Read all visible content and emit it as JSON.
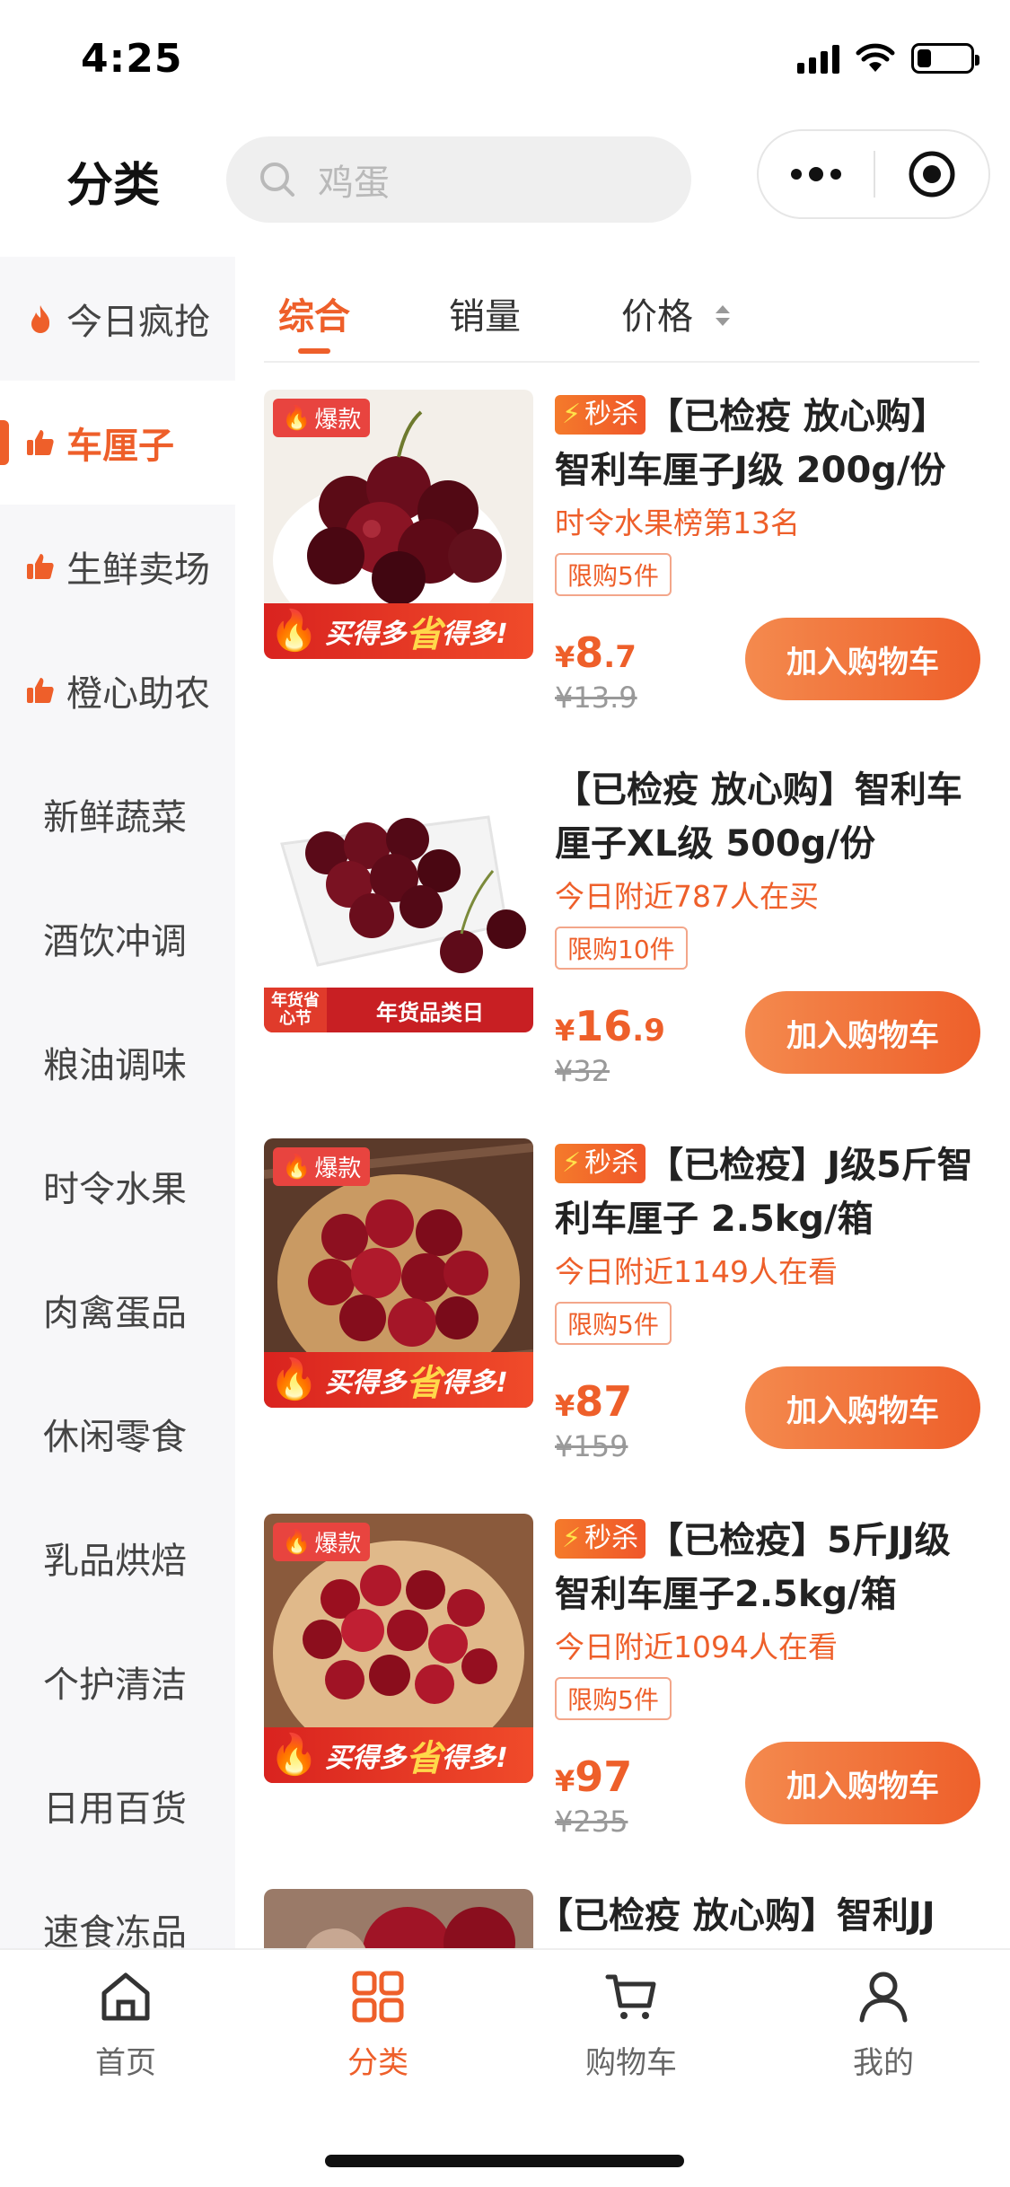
{
  "status_bar": {
    "time": "4:25",
    "battery_level": 0.26
  },
  "header": {
    "title": "分类",
    "search_placeholder": "鸡蛋"
  },
  "sidebar": {
    "items": [
      {
        "label": "今日疯抢",
        "icon": "flame-icon",
        "active": false
      },
      {
        "label": "车厘子",
        "icon": "thumbs-up-icon",
        "active": true
      },
      {
        "label": "生鲜卖场",
        "icon": "thumbs-up-icon",
        "active": false
      },
      {
        "label": "橙心助农",
        "icon": "thumbs-up-icon",
        "active": false
      },
      {
        "label": "新鲜蔬菜",
        "icon": "",
        "active": false
      },
      {
        "label": "酒饮冲调",
        "icon": "",
        "active": false
      },
      {
        "label": "粮油调味",
        "icon": "",
        "active": false
      },
      {
        "label": "时令水果",
        "icon": "",
        "active": false
      },
      {
        "label": "肉禽蛋品",
        "icon": "",
        "active": false
      },
      {
        "label": "休闲零食",
        "icon": "",
        "active": false
      },
      {
        "label": "乳品烘焙",
        "icon": "",
        "active": false
      },
      {
        "label": "个护清洁",
        "icon": "",
        "active": false
      },
      {
        "label": "日用百货",
        "icon": "",
        "active": false
      },
      {
        "label": "速食冻品",
        "icon": "",
        "active": false
      }
    ]
  },
  "sort_bar": {
    "comprehensive": "综合",
    "sales": "销量",
    "price": "价格"
  },
  "products": [
    {
      "tag": "秒杀",
      "title": "【已检疫 放心购】智利车厘子J级 200g/份",
      "subline": "时令水果榜第13名",
      "limit": "限购5件",
      "price_currency": "¥",
      "price_int": "8",
      "price_dec": ".7",
      "old_price": "¥13.9",
      "button": "加入购物车",
      "badge": "爆款",
      "promo": {
        "a": "买得多",
        "b": "省",
        "c": "得多!"
      }
    },
    {
      "tag": "",
      "title": "【已检疫 放心购】智利车厘子XL级 500g/份",
      "subline": "今日附近787人在买",
      "limit": "限购10件",
      "price_currency": "¥",
      "price_int": "16",
      "price_dec": ".9",
      "old_price": "¥32",
      "button": "加入购物车",
      "badge": "",
      "promo2": {
        "left": "年货省心节",
        "mid": "年货品类日"
      }
    },
    {
      "tag": "秒杀",
      "title": "【已检疫】J级5斤智利车厘子 2.5kg/箱",
      "subline": "今日附近1149人在看",
      "limit": "限购5件",
      "price_currency": "¥",
      "price_int": "87",
      "price_dec": "",
      "old_price": "¥159",
      "button": "加入购物车",
      "badge": "爆款",
      "promo": {
        "a": "买得多",
        "b": "省",
        "c": "得多!"
      }
    },
    {
      "tag": "秒杀",
      "title": "【已检疫】5斤JJ级智利车厘子2.5kg/箱",
      "subline": "今日附近1094人在看",
      "limit": "限购5件",
      "price_currency": "¥",
      "price_int": "97",
      "price_dec": "",
      "old_price": "¥235",
      "button": "加入购物车",
      "badge": "爆款",
      "promo": {
        "a": "买得多",
        "b": "省",
        "c": "得多!"
      }
    },
    {
      "tag": "",
      "title": "【已检疫 放心购】智利JJ",
      "partial": true
    }
  ],
  "tabbar": {
    "items": [
      {
        "label": "首页",
        "icon": "home-icon",
        "active": false
      },
      {
        "label": "分类",
        "icon": "category-grid-icon",
        "active": true
      },
      {
        "label": "购物车",
        "icon": "cart-icon",
        "active": false
      },
      {
        "label": "我的",
        "icon": "user-icon",
        "active": false
      }
    ]
  },
  "colors": {
    "accent": "#ee5f2a",
    "sidebar_bg": "#f7f7f9"
  }
}
